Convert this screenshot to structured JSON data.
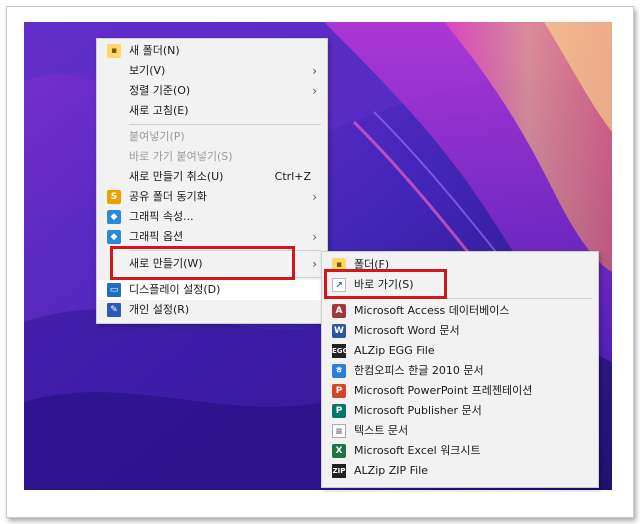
{
  "main_menu": {
    "items": [
      {
        "label": "새 폴더(N)",
        "icon": "folder-icon"
      },
      {
        "label": "보기(V)",
        "submenu": true
      },
      {
        "label": "정렬 기준(O)",
        "submenu": true
      },
      {
        "label": "새로 고침(E)"
      },
      {
        "label": "붙여넣기(P)",
        "disabled": true
      },
      {
        "label": "바로 가기 붙여넣기(S)",
        "disabled": true
      },
      {
        "label": "새로 만들기 취소(U)",
        "accel": "Ctrl+Z"
      },
      {
        "label": "공유 폴더 동기화",
        "icon": "sync-icon",
        "submenu": true
      },
      {
        "label": "그래픽 속성...",
        "icon": "graphics-icon"
      },
      {
        "label": "그래픽 옵션",
        "icon": "graphics-icon",
        "submenu": true
      },
      {
        "label": "새로 만들기(W)",
        "submenu": true
      },
      {
        "label": "디스플레이 설정(D)",
        "icon": "display-icon"
      },
      {
        "label": "개인 설정(R)",
        "icon": "personalize-icon"
      }
    ]
  },
  "sub_menu": {
    "items": [
      {
        "label": "폴더(F)",
        "icon": "folder-icon"
      },
      {
        "label": "바로 가기(S)",
        "icon": "shortcut-icon"
      },
      {
        "label": "Microsoft Access 데이터베이스",
        "icon": "access-icon"
      },
      {
        "label": "Microsoft Word 문서",
        "icon": "word-icon"
      },
      {
        "label": "ALZip EGG File",
        "icon": "egg-icon"
      },
      {
        "label": "한컴오피스 한글 2010 문서",
        "icon": "hwp-icon"
      },
      {
        "label": "Microsoft PowerPoint 프레젠테이션",
        "icon": "powerpoint-icon"
      },
      {
        "label": "Microsoft Publisher 문서",
        "icon": "publisher-icon"
      },
      {
        "label": "텍스트 문서",
        "icon": "text-document-icon"
      },
      {
        "label": "Microsoft Excel 워크시트",
        "icon": "excel-icon"
      },
      {
        "label": "ALZip ZIP File",
        "icon": "zip-icon"
      }
    ]
  },
  "colors": {
    "highlight_border": "#d01818",
    "menu_bg": "#f2f2f2",
    "disabled_text": "#9a9a9a"
  }
}
